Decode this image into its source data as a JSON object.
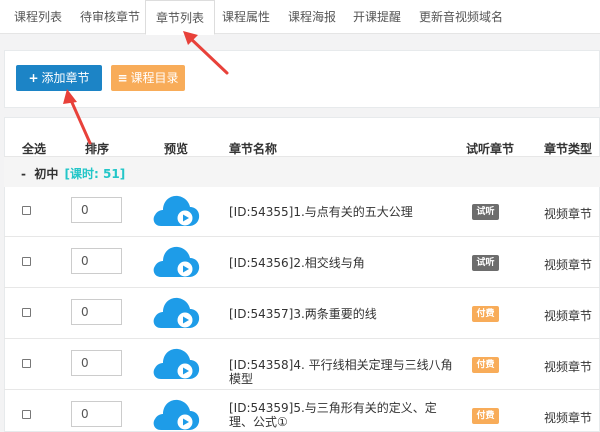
{
  "tabs": [
    {
      "label": "课程列表"
    },
    {
      "label": "待审核章节"
    },
    {
      "label": "章节列表"
    },
    {
      "label": "课程属性"
    },
    {
      "label": "课程海报"
    },
    {
      "label": "开课提醒"
    },
    {
      "label": "更新音视频域名"
    }
  ],
  "active_tab": "章节列表",
  "toolbar": {
    "add_label": "添加章节",
    "catalog_label": "课程目录",
    "colors": {
      "add": "#1c84c6",
      "catalog": "#f8ac59"
    }
  },
  "table": {
    "headers": {
      "select": "全选",
      "sort": "排序",
      "preview": "预览",
      "name": "章节名称",
      "trial": "试听章节",
      "type": "章节类型"
    },
    "group": {
      "toggle": "-",
      "name": "初中",
      "count": "[课时: 51]"
    },
    "rows": [
      {
        "sort": "0",
        "name": "[ID:54355]1.与点有关的五大公理",
        "badge": "试听",
        "badge_kind": "trial",
        "type": "视频章节"
      },
      {
        "sort": "0",
        "name": "[ID:54356]2.相交线与角",
        "badge": "试听",
        "badge_kind": "trial",
        "type": "视频章节"
      },
      {
        "sort": "0",
        "name": "[ID:54357]3.两条重要的线",
        "badge": "付费",
        "badge_kind": "paid",
        "type": "视频章节"
      },
      {
        "sort": "0",
        "name": "[ID:54358]4. 平行线相关定理与三线八角模型",
        "badge": "付费",
        "badge_kind": "paid",
        "type": "视频章节"
      },
      {
        "sort": "0",
        "name": "[ID:54359]5.与三角形有关的定义、定理、公式①",
        "badge": "付费",
        "badge_kind": "paid",
        "type": "视频章节"
      }
    ]
  },
  "colors": {
    "accent": "#1c84c6",
    "cloud": "#1e9ce8",
    "annotation_arrow": "#e8413a",
    "group_count": "#23c6c8"
  }
}
